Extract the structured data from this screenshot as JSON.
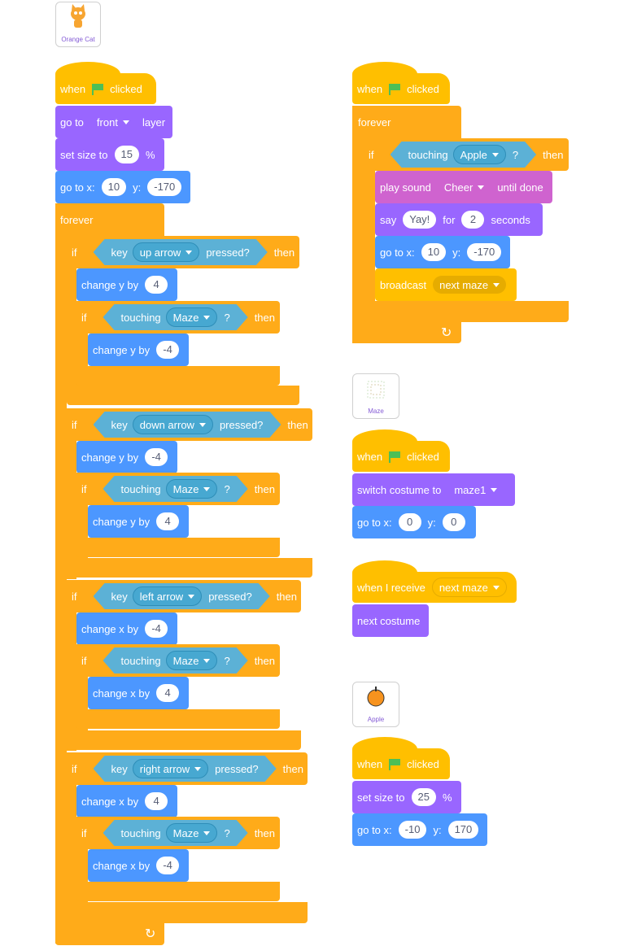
{
  "sprites": {
    "cat": "Orange Cat",
    "maze": "Maze",
    "apple": "Apple"
  },
  "common": {
    "when": "when",
    "clicked": "clicked",
    "forever": "forever",
    "if": "if",
    "then": "then",
    "key": "key",
    "pressed": "pressed?",
    "touching": "touching",
    "qmark": "?",
    "change_y_by": "change y by",
    "change_x_by": "change x by",
    "go_to_x": "go to x:",
    "y": "y:",
    "set_size_to": "set size to",
    "percent": "%"
  },
  "cat": {
    "go_to": "go to",
    "front": "front",
    "layer": "layer",
    "size": "15",
    "gx": "10",
    "gy": "-170",
    "up_arrow": "up arrow",
    "down_arrow": "down arrow",
    "left_arrow": "left arrow",
    "right_arrow": "right arrow",
    "maze_opt": "Maze",
    "v4": "4",
    "vneg4": "-4"
  },
  "right1": {
    "apple_opt": "Apple",
    "play_sound": "play sound",
    "cheer": "Cheer",
    "until_done": "until done",
    "say": "say",
    "yay": "Yay!",
    "for": "for",
    "two": "2",
    "seconds": "seconds",
    "gx": "10",
    "gy": "-170",
    "broadcast": "broadcast",
    "next_maze": "next maze"
  },
  "mazecode": {
    "switch_costume": "switch costume to",
    "maze1": "maze1",
    "gx": "0",
    "gy": "0",
    "when_receive": "when I receive",
    "next_maze": "next maze",
    "next_costume": "next costume"
  },
  "applecode": {
    "size": "25",
    "gx": "-10",
    "gy": "170"
  }
}
